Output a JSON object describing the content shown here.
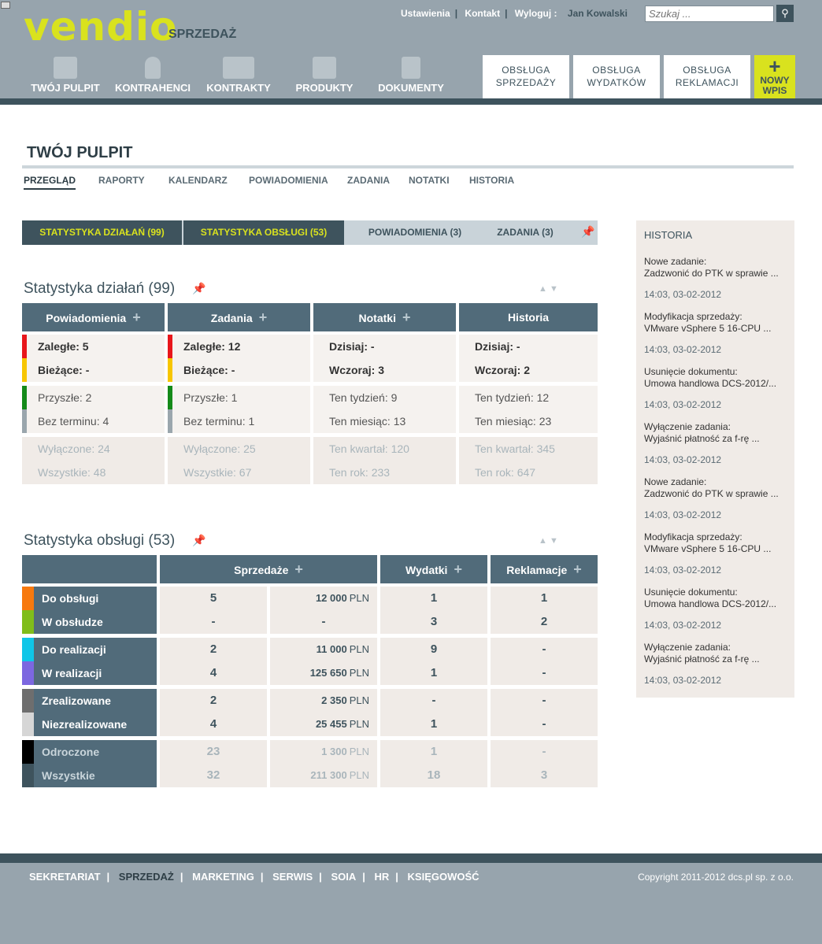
{
  "header": {
    "logo": "vendio",
    "app_name": "SPRZEDAŻ",
    "links": [
      "Ustawienia",
      "Kontakt",
      "Wyloguj :"
    ],
    "user": "Jan Kowalski",
    "search_placeholder": "Szukaj ...",
    "nav": [
      "TWÓJ PULPIT",
      "KONTRAHENCI",
      "KONTRAKTY",
      "PRODUKTY",
      "DOKUMENTY"
    ],
    "services": [
      {
        "line1": "OBSŁUGA",
        "line2": "SPRZEDAŻY"
      },
      {
        "line1": "OBSŁUGA",
        "line2": "WYDATKÓW"
      },
      {
        "line1": "OBSŁUGA",
        "line2": "REKLAMACJI"
      }
    ],
    "new_entry": {
      "line1": "NOWY",
      "line2": "WPIS"
    }
  },
  "page": {
    "title": "TWÓJ PULPIT",
    "subtabs": [
      "PRZEGLĄD",
      "RAPORTY",
      "KALENDARZ",
      "POWIADOMIENIA",
      "ZADANIA",
      "NOTATKI",
      "HISTORIA"
    ],
    "tabbar": [
      "STATYSTYKA DZIAŁAŃ  (99)",
      "STATYSTYKA OBSŁUGI  (53)",
      "POWIADOMIENIA  (3)",
      "ZADANIA  (3)"
    ]
  },
  "activity": {
    "title": "Statystyka działań (99)",
    "columns": [
      {
        "name": "Powiadomienia",
        "rows": [
          "Zaległe: 5",
          "Bieżące: -",
          "Przyszłe: 2",
          "Bez terminu: 4",
          "Wyłączone: 24",
          "Wszystkie: 48"
        ]
      },
      {
        "name": "Zadania",
        "rows": [
          "Zaległe: 12",
          "Bieżące: -",
          "Przyszłe: 1",
          "Bez terminu: 1",
          "Wyłączone: 25",
          "Wszystkie: 67"
        ]
      },
      {
        "name": "Notatki",
        "rows": [
          "Dzisiaj: -",
          "Wczoraj: 3",
          "Ten tydzień: 9",
          "Ten miesiąc: 13",
          "Ten kwartał: 120",
          "Ten rok: 233"
        ]
      },
      {
        "name": "Historia",
        "rows": [
          "Dzisiaj: -",
          "Wczoraj: 2",
          "Ten tydzień: 12",
          "Ten miesiąc: 23",
          "Ten kwartał: 345",
          "Ten rok: 647"
        ]
      }
    ],
    "mark_colors": [
      "#e8161b",
      "#f7c600",
      "#148a19",
      "#9aa6ad"
    ]
  },
  "service": {
    "title": "Statystyka obsługi (53)",
    "columns": [
      "Sprzedaże",
      "Wydatki",
      "Reklamacje"
    ],
    "currency": "PLN",
    "rows": [
      {
        "label": "Do obsługi",
        "color": "#f7790e",
        "count": "5",
        "amount": "12 000",
        "exp": "1",
        "rec": "1"
      },
      {
        "label": "W obsłudze",
        "color": "#80bd1a",
        "count": "-",
        "amount": "-",
        "exp": "3",
        "rec": "2"
      },
      {
        "label": "Do realizacji",
        "color": "#0fc6e8",
        "count": "2",
        "amount": "11 000",
        "exp": "9",
        "rec": "-"
      },
      {
        "label": "W realizacji",
        "color": "#7c67e0",
        "count": "4",
        "amount": "125 650",
        "exp": "1",
        "rec": "-"
      },
      {
        "label": "Zrealizowane",
        "color": "#6e6e6e",
        "count": "2",
        "amount": "2 350",
        "exp": "-",
        "rec": "-"
      },
      {
        "label": "Niezrealizowane",
        "color": "#d6d6d6",
        "count": "4",
        "amount": "25 455",
        "exp": "1",
        "rec": "-"
      },
      {
        "label": "Odroczone",
        "color": "#000000",
        "count": "23",
        "amount": "1 300",
        "exp": "1",
        "rec": "-"
      },
      {
        "label": "Wszystkie",
        "color": "#3e535d",
        "count": "32",
        "amount": "211 300",
        "exp": "18",
        "rec": "3"
      }
    ]
  },
  "history": {
    "title": "HISTORIA",
    "items": [
      {
        "type": "Nowe zadanie:",
        "text": "Zadzwonić do PTK w sprawie ...",
        "time": "14:03,  03-02-2012"
      },
      {
        "type": "Modyfikacja sprzedaży:",
        "text": "VMware vSphere 5 16-CPU ...",
        "time": "14:03,  03-02-2012"
      },
      {
        "type": "Usunięcie dokumentu:",
        "text": "Umowa handlowa DCS-2012/...",
        "time": "14:03,  03-02-2012"
      },
      {
        "type": "Wyłączenie zadania:",
        "text": "Wyjaśnić płatność za f-rę ...",
        "time": "14:03,  03-02-2012"
      },
      {
        "type": "Nowe zadanie:",
        "text": "Zadzwonić do PTK w sprawie ...",
        "time": "14:03,  03-02-2012"
      },
      {
        "type": "Modyfikacja sprzedaży:",
        "text": "VMware vSphere 5 16-CPU ...",
        "time": "14:03,  03-02-2012"
      },
      {
        "type": "Usunięcie dokumentu:",
        "text": "Umowa handlowa DCS-2012/...",
        "time": "14:03,  03-02-2012"
      },
      {
        "type": "Wyłączenie zadania:",
        "text": "Wyjaśnić płatność za f-rę ...",
        "time": "14:03,  03-02-2012"
      }
    ]
  },
  "footer": {
    "links": [
      "SEKRETARIAT",
      "SPRZEDAŻ",
      "MARKETING",
      "SERWIS",
      "SOIA",
      "HR",
      "KSIĘGOWOŚĆ"
    ],
    "copyright": "Copyright 2011-2012 dcs.pl sp. z o.o."
  }
}
